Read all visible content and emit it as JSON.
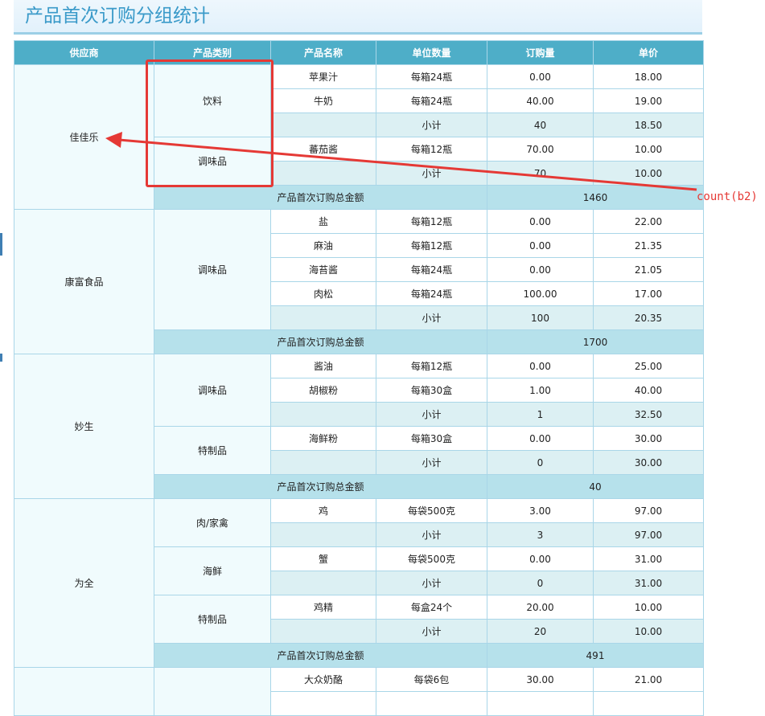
{
  "page": {
    "title": "产品首次订购分组统计",
    "annotation": "count(b2)"
  },
  "colors": {
    "header_bg": "#4eaec8",
    "group_bg": "#f0fbfd",
    "subtotal_bg": "#dcf0f3",
    "total_bg": "#b6e1eb",
    "annotation_red": "#e53935",
    "title_blue": "#3a9ac9"
  },
  "table": {
    "headers": [
      "供应商",
      "产品类别",
      "产品名称",
      "单位数量",
      "订购量",
      "单价"
    ],
    "subtotal_label": "小计",
    "total_label": "产品首次订购总金额",
    "suppliers": [
      {
        "name": "佳佳乐",
        "total": "1460",
        "categories": [
          {
            "name": "饮料",
            "items": [
              {
                "product": "苹果汁",
                "unit": "每箱24瓶",
                "qty": "0.00",
                "price": "18.00"
              },
              {
                "product": "牛奶",
                "unit": "每箱24瓶",
                "qty": "40.00",
                "price": "19.00"
              }
            ],
            "subtotal": {
              "qty": "40",
              "price": "18.50"
            }
          },
          {
            "name": "调味品",
            "items": [
              {
                "product": "蕃茄酱",
                "unit": "每箱12瓶",
                "qty": "70.00",
                "price": "10.00"
              }
            ],
            "subtotal": {
              "qty": "70",
              "price": "10.00"
            }
          }
        ]
      },
      {
        "name": "康富食品",
        "total": "1700",
        "categories": [
          {
            "name": "调味品",
            "items": [
              {
                "product": "盐",
                "unit": "每箱12瓶",
                "qty": "0.00",
                "price": "22.00"
              },
              {
                "product": "麻油",
                "unit": "每箱12瓶",
                "qty": "0.00",
                "price": "21.35"
              },
              {
                "product": "海苔酱",
                "unit": "每箱24瓶",
                "qty": "0.00",
                "price": "21.05"
              },
              {
                "product": "肉松",
                "unit": "每箱24瓶",
                "qty": "100.00",
                "price": "17.00"
              }
            ],
            "subtotal": {
              "qty": "100",
              "price": "20.35"
            }
          }
        ]
      },
      {
        "name": "妙生",
        "total": "40",
        "categories": [
          {
            "name": "调味品",
            "items": [
              {
                "product": "酱油",
                "unit": "每箱12瓶",
                "qty": "0.00",
                "price": "25.00"
              },
              {
                "product": "胡椒粉",
                "unit": "每箱30盒",
                "qty": "1.00",
                "price": "40.00"
              }
            ],
            "subtotal": {
              "qty": "1",
              "price": "32.50"
            }
          },
          {
            "name": "特制品",
            "items": [
              {
                "product": "海鲜粉",
                "unit": "每箱30盒",
                "qty": "0.00",
                "price": "30.00"
              }
            ],
            "subtotal": {
              "qty": "0",
              "price": "30.00"
            }
          }
        ]
      },
      {
        "name": "为全",
        "total": "491",
        "categories": [
          {
            "name": "肉/家禽",
            "items": [
              {
                "product": "鸡",
                "unit": "每袋500克",
                "qty": "3.00",
                "price": "97.00"
              }
            ],
            "subtotal": {
              "qty": "3",
              "price": "97.00"
            }
          },
          {
            "name": "海鲜",
            "items": [
              {
                "product": "蟹",
                "unit": "每袋500克",
                "qty": "0.00",
                "price": "31.00"
              }
            ],
            "subtotal": {
              "qty": "0",
              "price": "31.00"
            }
          },
          {
            "name": "特制品",
            "items": [
              {
                "product": "鸡精",
                "unit": "每盒24个",
                "qty": "20.00",
                "price": "10.00"
              }
            ],
            "subtotal": {
              "qty": "20",
              "price": "10.00"
            }
          }
        ]
      }
    ],
    "partial_supplier": {
      "name": "",
      "category": "",
      "items": [
        {
          "product": "大众奶酪",
          "unit": "每袋6包",
          "qty": "30.00",
          "price": "21.00"
        },
        {
          "product": "",
          "unit": "",
          "qty": "",
          "price": ""
        }
      ]
    }
  }
}
